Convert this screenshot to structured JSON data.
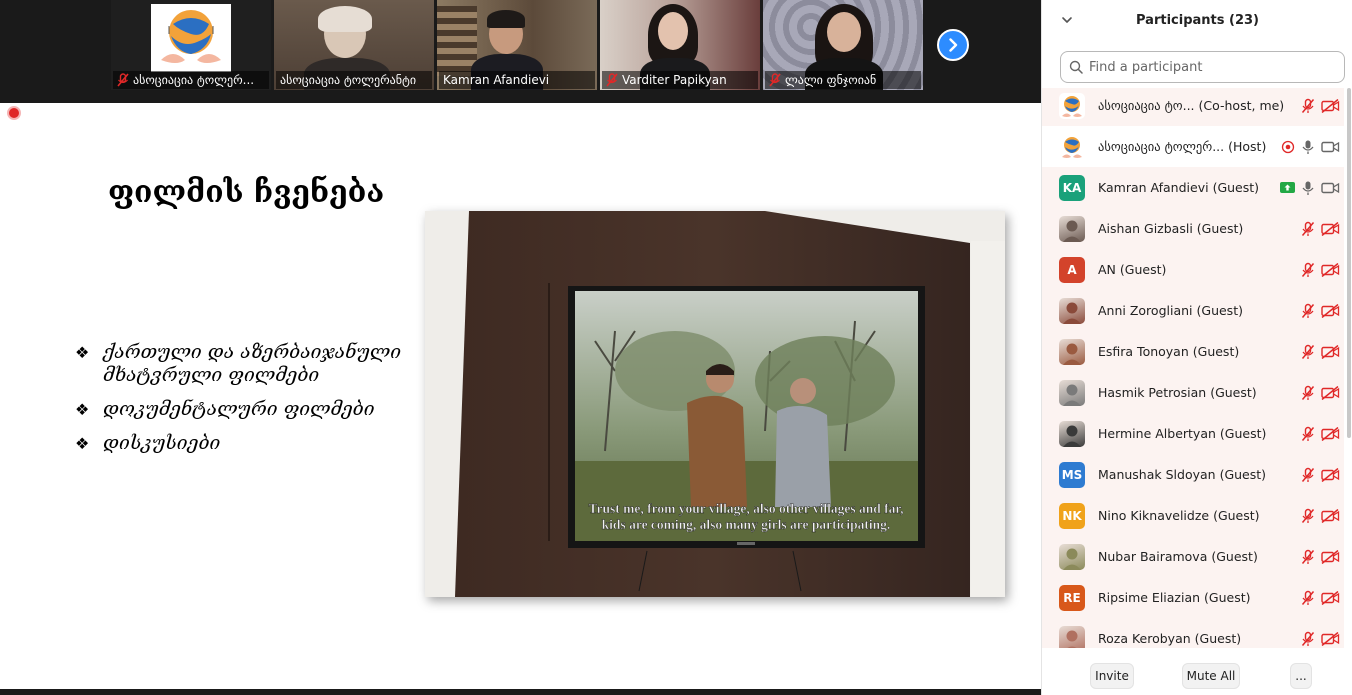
{
  "video_strip": {
    "tiles": [
      {
        "name": "ასოციაცია ტოლერ...",
        "muted": true
      },
      {
        "name": "ასოციაცია ტოლერანტი",
        "muted": false
      },
      {
        "name": "Kamran Afandievi",
        "muted": false
      },
      {
        "name": "Varditer Papikyan",
        "muted": true
      },
      {
        "name": "ლალი ფნჯოიან",
        "muted": true
      }
    ]
  },
  "slide": {
    "title": "ფილმის ჩვენება",
    "bullet_symbol": "❖",
    "bullets": [
      "ქართული და აზერბაიჯანული მხატვრული ფილმები",
      "დოკუმენტალური ფილმები",
      "დისკუსიები"
    ],
    "subtitle_line1": "Trust me, from your village, also other villages and far,",
    "subtitle_line2": "kids are coming, also many girls are participating."
  },
  "panel": {
    "title": "Participants (23)",
    "search_placeholder": "Find a participant",
    "participants": [
      {
        "name": "ასოციაცია ტო...",
        "role": "(Co-host, me)",
        "avatar_type": "logo",
        "initials": "",
        "color": "",
        "mic": "muted",
        "video": "off",
        "recording": false,
        "share": false,
        "tinted": true
      },
      {
        "name": "ასოციაცია ტოლერ...",
        "role": "(Host)",
        "avatar_type": "logo",
        "initials": "",
        "color": "",
        "mic": "on",
        "video": "on",
        "recording": true,
        "share": false,
        "tinted": false
      },
      {
        "name": "Kamran Afandievi",
        "role": "(Guest)",
        "avatar_type": "initials",
        "initials": "KA",
        "color": "#1aa17a",
        "mic": "on",
        "video": "on",
        "recording": false,
        "share": true,
        "tinted": true
      },
      {
        "name": "Aishan Gizbasli",
        "role": "(Guest)",
        "avatar_type": "photo",
        "initials": "",
        "color": "#6b5a52",
        "mic": "muted",
        "video": "off",
        "recording": false,
        "share": false,
        "tinted": true
      },
      {
        "name": "AN",
        "role": "(Guest)",
        "avatar_type": "initials",
        "initials": "A",
        "color": "#d3432b",
        "mic": "muted",
        "video": "off",
        "recording": false,
        "share": false,
        "tinted": true
      },
      {
        "name": "Anni Zorogliani",
        "role": "(Guest)",
        "avatar_type": "photo",
        "initials": "",
        "color": "#8a4a3a",
        "mic": "muted",
        "video": "off",
        "recording": false,
        "share": false,
        "tinted": true
      },
      {
        "name": "Esfira Tonoyan",
        "role": "(Guest)",
        "avatar_type": "photo",
        "initials": "",
        "color": "#9a5a40",
        "mic": "muted",
        "video": "off",
        "recording": false,
        "share": false,
        "tinted": true
      },
      {
        "name": "Hasmik Petrosian",
        "role": "(Guest)",
        "avatar_type": "photo",
        "initials": "",
        "color": "#7a7a7a",
        "mic": "muted",
        "video": "off",
        "recording": false,
        "share": false,
        "tinted": true
      },
      {
        "name": "Hermine Albertyan",
        "role": "(Guest)",
        "avatar_type": "photo",
        "initials": "",
        "color": "#3a3a3a",
        "mic": "muted",
        "video": "off",
        "recording": false,
        "share": false,
        "tinted": true
      },
      {
        "name": "Manushak Sldoyan",
        "role": "(Guest)",
        "avatar_type": "initials",
        "initials": "MS",
        "color": "#2e7bd1",
        "mic": "muted",
        "video": "off",
        "recording": false,
        "share": false,
        "tinted": true
      },
      {
        "name": "Nino Kiknavelidze",
        "role": "(Guest)",
        "avatar_type": "initials",
        "initials": "NK",
        "color": "#f0a21a",
        "mic": "muted",
        "video": "off",
        "recording": false,
        "share": false,
        "tinted": true
      },
      {
        "name": "Nubar Bairamova",
        "role": "(Guest)",
        "avatar_type": "photo",
        "initials": "",
        "color": "#8b8a5a",
        "mic": "muted",
        "video": "off",
        "recording": false,
        "share": false,
        "tinted": true
      },
      {
        "name": "Ripsime Eliazian",
        "role": "(Guest)",
        "avatar_type": "initials",
        "initials": "RE",
        "color": "#d8581a",
        "mic": "muted",
        "video": "off",
        "recording": false,
        "share": false,
        "tinted": true
      },
      {
        "name": "Roza Kerobyan",
        "role": "(Guest)",
        "avatar_type": "photo",
        "initials": "",
        "color": "#b07060",
        "mic": "muted",
        "video": "off",
        "recording": false,
        "share": false,
        "tinted": true
      }
    ],
    "footer": {
      "invite_label": "Invite",
      "mute_all_label": "Mute All",
      "more_label": "..."
    }
  },
  "colors": {
    "accent": "#2d8cff",
    "muted_red": "#e02828",
    "share_green": "#22a845",
    "row_tint": "#fcf3f1"
  }
}
